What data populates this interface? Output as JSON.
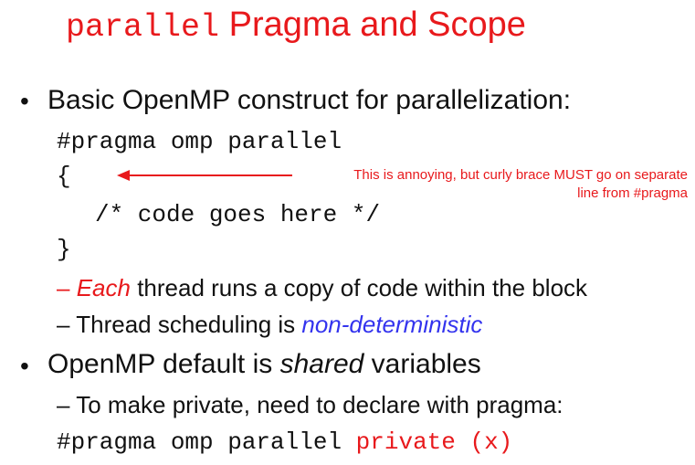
{
  "title": {
    "mono_part": "parallel",
    "rest": "Pragma and Scope"
  },
  "bullets": [
    {
      "text": "Basic OpenMP construct for parallelization:",
      "code": [
        "#pragma omp parallel",
        "{",
        "/* code goes here */",
        "}"
      ],
      "note": {
        "line1": "This is annoying, but curly brace MUST go on separate",
        "line2": "line from #pragma"
      },
      "subs": [
        {
          "dash": "–",
          "em": "Each",
          "rest": " thread runs a copy of code within the block"
        },
        {
          "dash": "–",
          "pre": "Thread scheduling is ",
          "em": "non-deterministic"
        }
      ]
    },
    {
      "pre": "OpenMP default is ",
      "em": "shared",
      "post": " variables",
      "subs": [
        {
          "dash": "–",
          "text": "To make private, need to declare with pragma:"
        }
      ],
      "code": {
        "plain": "#pragma omp parallel ",
        "highlight": "private (x)"
      }
    }
  ],
  "bullet_symbol": "•",
  "colors": {
    "accent_red": "#e8191c",
    "accent_blue": "#3333ee",
    "text": "#111111"
  }
}
